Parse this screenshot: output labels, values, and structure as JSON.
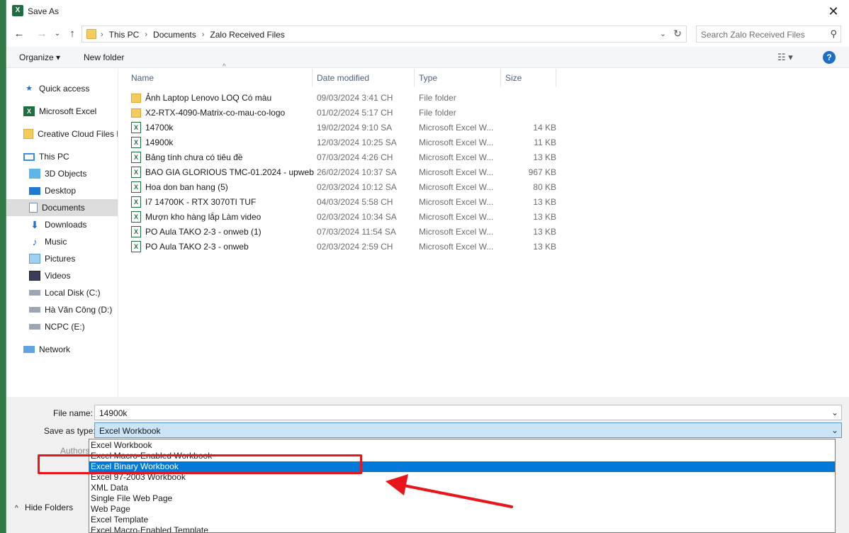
{
  "window": {
    "title": "Save As",
    "app_icon": "excel-icon"
  },
  "nav": {
    "breadcrumbs": [
      "This PC",
      "Documents",
      "Zalo Received Files"
    ],
    "search_placeholder": "Search Zalo Received Files"
  },
  "toolbar": {
    "organize": "Organize ▾",
    "new_folder": "New folder"
  },
  "sidebar": {
    "items": [
      {
        "label": "Quick access",
        "icon": "star-icon"
      },
      {
        "label": "Microsoft Excel",
        "icon": "excel-icon"
      },
      {
        "label": "Creative Cloud Files P",
        "icon": "folder-icon"
      },
      {
        "label": "This PC",
        "icon": "computer-icon"
      },
      {
        "label": "3D Objects",
        "icon": "cube-icon"
      },
      {
        "label": "Desktop",
        "icon": "desktop-icon"
      },
      {
        "label": "Documents",
        "icon": "document-icon"
      },
      {
        "label": "Downloads",
        "icon": "download-icon"
      },
      {
        "label": "Music",
        "icon": "music-icon"
      },
      {
        "label": "Pictures",
        "icon": "picture-icon"
      },
      {
        "label": "Videos",
        "icon": "video-icon"
      },
      {
        "label": "Local Disk (C:)",
        "icon": "drive-icon"
      },
      {
        "label": "Hà Văn Công (D:)",
        "icon": "drive-icon"
      },
      {
        "label": "NCPC (E:)",
        "icon": "drive-icon"
      },
      {
        "label": "Network",
        "icon": "network-icon"
      }
    ]
  },
  "files": {
    "columns": [
      "Name",
      "Date modified",
      "Type",
      "Size"
    ],
    "rows": [
      {
        "name": "Ảnh Laptop Lenovo LOQ Có màu",
        "date": "09/03/2024 3:41 CH",
        "type": "File folder",
        "size": "",
        "kind": "folder"
      },
      {
        "name": "X2-RTX-4090-Matrix-co-mau-co-logo",
        "date": "01/02/2024 5:17 CH",
        "type": "File folder",
        "size": "",
        "kind": "folder"
      },
      {
        "name": "14700k",
        "date": "19/02/2024 9:10 SA",
        "type": "Microsoft Excel W...",
        "size": "14 KB",
        "kind": "excel"
      },
      {
        "name": "14900k",
        "date": "12/03/2024 10:25 SA",
        "type": "Microsoft Excel W...",
        "size": "11 KB",
        "kind": "excel"
      },
      {
        "name": "Bảng tính chưa có tiêu đề",
        "date": "07/03/2024 4:26 CH",
        "type": "Microsoft Excel W...",
        "size": "13 KB",
        "kind": "excel"
      },
      {
        "name": "BAO GIA GLORIOUS TMC-01.2024 - upweb",
        "date": "26/02/2024 10:37 SA",
        "type": "Microsoft Excel W...",
        "size": "967 KB",
        "kind": "excel"
      },
      {
        "name": "Hoa don ban hang (5)",
        "date": "02/03/2024 10:12 SA",
        "type": "Microsoft Excel W...",
        "size": "80 KB",
        "kind": "excel"
      },
      {
        "name": "I7 14700K -  RTX 3070TI TUF",
        "date": "04/03/2024 5:58 CH",
        "type": "Microsoft Excel W...",
        "size": "13 KB",
        "kind": "excel"
      },
      {
        "name": "Mượn kho hàng lắp Làm video",
        "date": "02/03/2024 10:34 SA",
        "type": "Microsoft Excel W...",
        "size": "13 KB",
        "kind": "excel"
      },
      {
        "name": "PO Aula TAKO  2-3 - onweb (1)",
        "date": "07/03/2024 11:54 SA",
        "type": "Microsoft Excel W...",
        "size": "13 KB",
        "kind": "excel"
      },
      {
        "name": "PO Aula TAKO  2-3 - onweb",
        "date": "02/03/2024 2:59 CH",
        "type": "Microsoft Excel W...",
        "size": "13 KB",
        "kind": "excel"
      }
    ]
  },
  "form": {
    "file_name_label": "File name:",
    "file_name_value": "14900k",
    "save_type_label": "Save as type:",
    "save_type_value": "Excel Workbook",
    "authors_label": "Authors:",
    "hide_folders": "Hide Folders"
  },
  "type_options": [
    "Excel Workbook",
    "Excel Macro-Enabled Workbook",
    "Excel Binary Workbook",
    "Excel 97-2003 Workbook",
    "XML Data",
    "Single File Web Page",
    "Web Page",
    "Excel Template",
    "Excel Macro-Enabled Template"
  ],
  "highlighted_option": "Excel Binary Workbook",
  "colors": {
    "accent": "#0078d7",
    "annotation": "#e8151b",
    "excel_green": "#1d6f42"
  }
}
